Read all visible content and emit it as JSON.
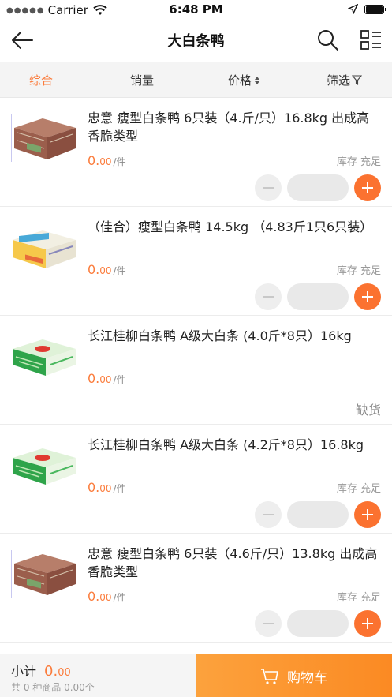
{
  "status_bar": {
    "carrier": "Carrier",
    "time": "6:48 PM"
  },
  "nav": {
    "title": "大白条鸭"
  },
  "filters": [
    {
      "label": "综合",
      "active": true
    },
    {
      "label": "销量",
      "active": false
    },
    {
      "label": "价格",
      "active": false
    },
    {
      "label": "筛选",
      "active": false
    }
  ],
  "products": [
    {
      "name": "忠意  瘦型白条鸭   6只装（4.斤/只）16.8kg   出成高  香脆类型",
      "price_int": "0.",
      "price_dec": "00",
      "unit": "/件",
      "stock": "库存 充足",
      "image": "red-box-product-image"
    },
    {
      "name": "（佳合）瘦型白条鸭 14.5kg                           （4.83斤1只6只装）",
      "price_int": "0.",
      "price_dec": "00",
      "unit": "/件",
      "stock": "库存 充足",
      "image": "white-box-product-image"
    },
    {
      "name": "长江桂柳白条鸭 A级大白条 (4.0斤*8只）16kg",
      "price_int": "0.",
      "price_dec": "00",
      "unit": "/件",
      "stock": "缺货",
      "image": "green-box-product-image"
    },
    {
      "name": "长江桂柳白条鸭 A级大白条 (4.2斤*8只）16.8kg",
      "price_int": "0.",
      "price_dec": "00",
      "unit": "/件",
      "stock": "库存 充足",
      "image": "green-box-product-image"
    },
    {
      "name": "忠意  瘦型白条鸭   6只装（4.6斤/只）13.8kg   出成高  香脆类型",
      "price_int": "0.",
      "price_dec": "00",
      "unit": "/件",
      "stock": "库存 充足",
      "image": "red-box-product-image"
    }
  ],
  "cart": {
    "subtotal_label": "小计",
    "subtotal_int": "0.",
    "subtotal_dec": "00",
    "summary": "共 0 种商品 0.00个",
    "button_label": "购物车"
  },
  "colors": {
    "accent": "#fb7c3c",
    "plus_button": "#fb7230",
    "cart_gradient_start": "#fca23d",
    "cart_gradient_end": "#fb8a23"
  }
}
